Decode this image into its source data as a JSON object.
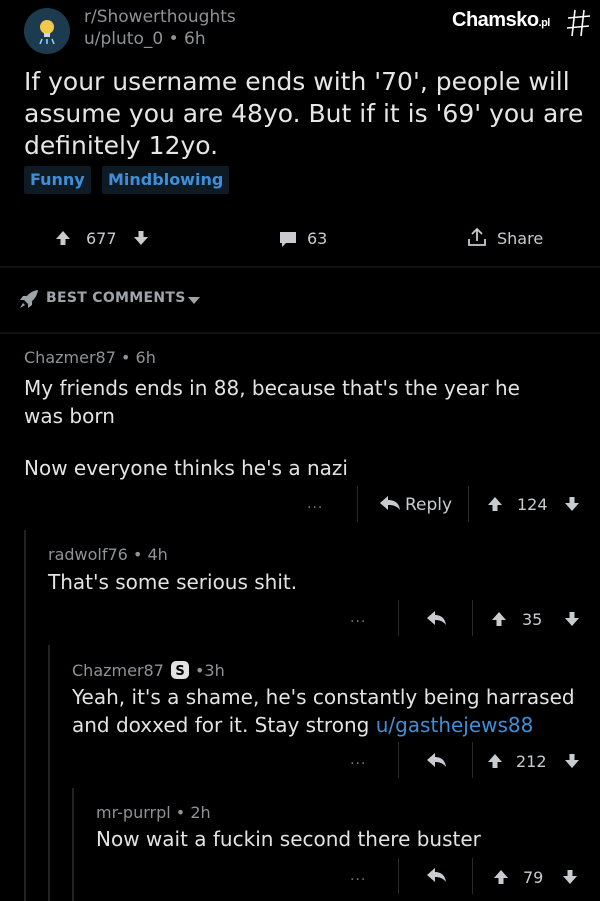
{
  "post": {
    "subreddit": "r/Showerthoughts",
    "author": "u/pluto_0",
    "time": "6h",
    "title": "If your username ends with '70', people will assume you are 48yo. But if it is '69' you are definitely 12yo.",
    "flairs": [
      "Funny",
      "Mindblowing"
    ],
    "votes": "677",
    "comments": "63",
    "share_label": "Share"
  },
  "watermark": {
    "brand": "Chamsko",
    "tld": ".pl"
  },
  "sort_label": "BEST COMMENTS",
  "comments": [
    {
      "author": "Chazmer87",
      "time": "6h",
      "body_1": "My friends ends in 88, because that's the year he was born",
      "body_2": "Now everyone thinks he's a nazi",
      "more": "...",
      "reply_label": "Reply",
      "score": "124"
    },
    {
      "author": "radwolf76",
      "time": "4h",
      "body": "That's some serious shit.",
      "more": "...",
      "score": "35"
    },
    {
      "author": "Chazmer87",
      "time": "3h",
      "body": "Yeah, it's a shame, he's constantly being harrased and doxxed for it.  Stay strong",
      "link": "u/gasthejews88",
      "more": "...",
      "score": "212"
    },
    {
      "author": "mr-purrpl",
      "time": "2h",
      "body": "Now wait a fuckin second there buster",
      "more": "...",
      "score": "79"
    }
  ],
  "colors": {
    "background": "#000000",
    "link": "#3f8fd8",
    "text": "#e3e3e3",
    "muted": "#8e9396"
  }
}
